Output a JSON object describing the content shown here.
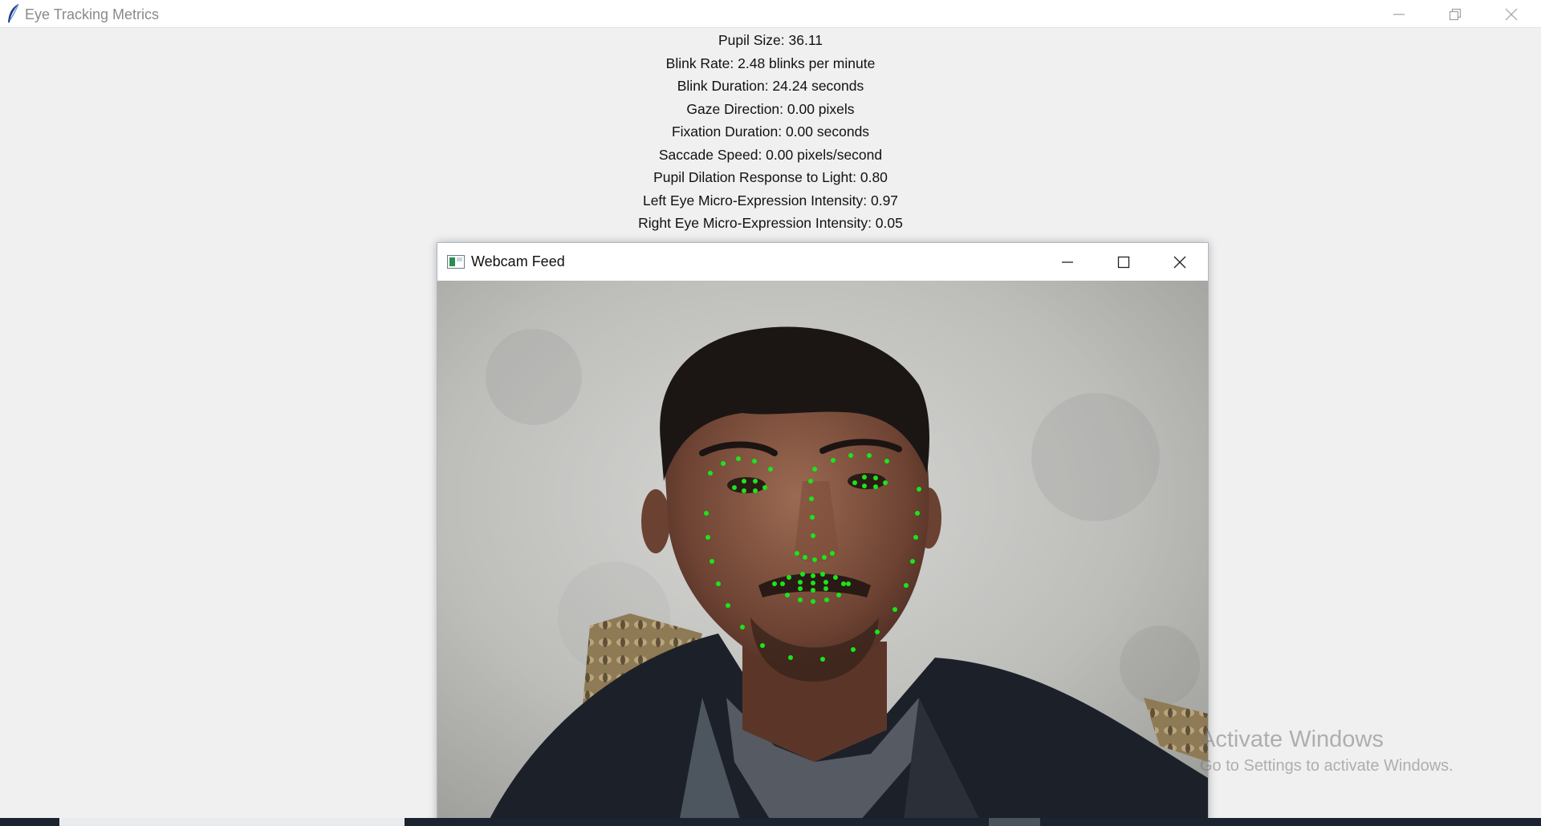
{
  "main_window": {
    "title": "Eye Tracking Metrics"
  },
  "metrics": [
    "Pupil Size: 36.11",
    "Blink Rate: 2.48 blinks per minute",
    "Blink Duration: 24.24 seconds",
    "Gaze Direction: 0.00 pixels",
    "Fixation Duration: 0.00 seconds",
    "Saccade Speed: 0.00 pixels/second",
    "Pupil Dilation Response to Light: 0.80",
    "Left Eye Micro-Expression Intensity: 0.97",
    "Right Eye Micro-Expression Intensity: 0.05"
  ],
  "webcam_window": {
    "title": "Webcam Feed"
  },
  "watermark": {
    "line1": "Activate Windows",
    "line2": "Go to Settings to activate Windows."
  },
  "colors": {
    "landmark": "#19e619",
    "window_bg": "#f0f0f0"
  },
  "icons": {
    "main_app": "tk-feather-icon",
    "webcam_app": "opencv-window-icon"
  }
}
